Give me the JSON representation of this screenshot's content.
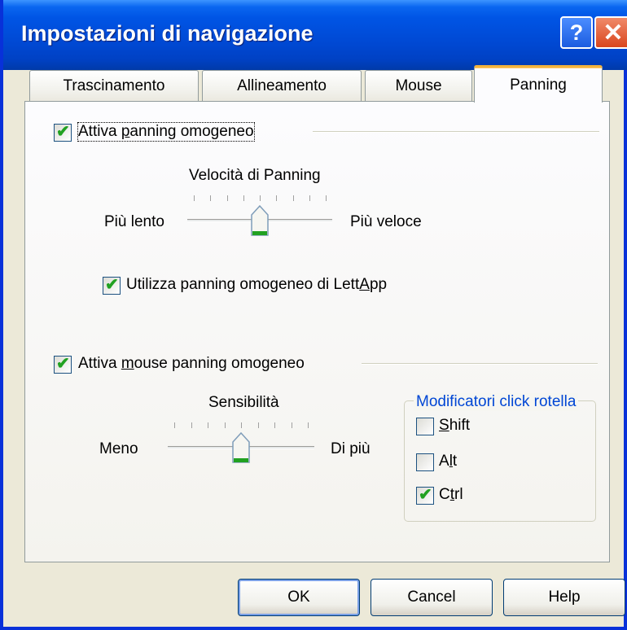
{
  "window": {
    "title": "Impostazioni di navigazione",
    "help_glyph": "?",
    "close_glyph": "✕"
  },
  "tabs": [
    {
      "label": "Trascinamento",
      "active": false
    },
    {
      "label": "Allineamento",
      "active": false
    },
    {
      "label": "Mouse",
      "active": false
    },
    {
      "label": "Panning",
      "active": true
    }
  ],
  "smooth_panning": {
    "checkbox_pre": "Attiva ",
    "checkbox_u": "p",
    "checkbox_post": "anning omogeneo",
    "checked": true,
    "slider": {
      "title": "Velocità di Panning",
      "min_label": "Più lento",
      "max_label": "Più veloce",
      "value_fraction": 0.5,
      "tick_count": 9
    },
    "lettapp_pre": "Utilizza panning omogeneo di Lett",
    "lettapp_u": "A",
    "lettapp_post": "pp",
    "lettapp_checked": true
  },
  "mouse_panning": {
    "checkbox_pre": "Attiva ",
    "checkbox_u": "m",
    "checkbox_post": "ouse panning omogeneo",
    "checked": true,
    "slider": {
      "title": "Sensibilità",
      "min_label": "Meno",
      "max_label": "Di più",
      "value_fraction": 0.5,
      "tick_count": 9
    },
    "modifiers": {
      "title": "Modificatori click rotella",
      "shift_pre": "",
      "shift_u": "S",
      "shift_post": "hift",
      "shift_checked": false,
      "alt_pre": "A",
      "alt_u": "l",
      "alt_post": "t",
      "alt_checked": false,
      "ctrl_pre": "C",
      "ctrl_u": "t",
      "ctrl_post": "rl",
      "ctrl_checked": true
    }
  },
  "buttons": {
    "ok": "OK",
    "cancel": "Cancel",
    "help": "Help"
  },
  "colors": {
    "accent": "#0054e3",
    "check": "#21a121",
    "group_title": "#0046d5"
  }
}
